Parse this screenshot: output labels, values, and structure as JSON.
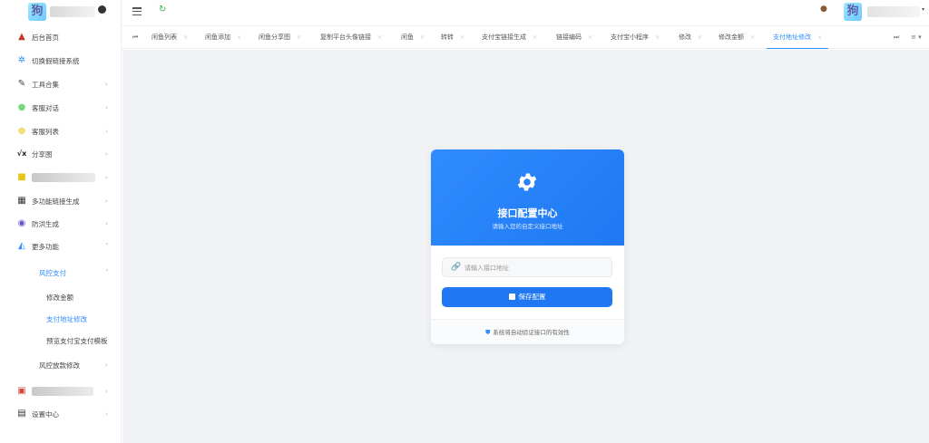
{
  "logo": {
    "avatar_text": "狗"
  },
  "sidebar": {
    "items": [
      {
        "label": "后台首页",
        "icon": "▲",
        "arrow": ""
      },
      {
        "label": "切换假链接系统",
        "icon": "✲",
        "arrow": ""
      },
      {
        "label": "工具合集",
        "icon": "✎",
        "arrow": "›"
      },
      {
        "label": "客服对话",
        "icon": "●",
        "arrow": "›"
      },
      {
        "label": "客服列表",
        "icon": "●",
        "arrow": "›"
      },
      {
        "label": "分享图",
        "icon": "√x",
        "arrow": "›"
      },
      {
        "label": "",
        "icon": "■",
        "arrow": "›"
      },
      {
        "label": "多功能链接生成",
        "icon": "▦",
        "arrow": "›"
      },
      {
        "label": "防洪生成",
        "icon": "◉",
        "arrow": "›"
      },
      {
        "label": "更多功能",
        "icon": "◭",
        "arrow": "˅"
      }
    ],
    "risk": {
      "label": "风控支付",
      "arrow": "˅"
    },
    "risk_sub": [
      "修改金额",
      "支付地址修改",
      "预览支付宝支付模板"
    ],
    "risk_count": {
      "label": "风控放款修改",
      "arrow": "›"
    },
    "hidden_item": {
      "icon": "▣",
      "arrow": "›"
    },
    "settings": {
      "label": "设置中心",
      "icon": "▤",
      "arrow": "›"
    }
  },
  "header": {
    "user_avatar_text": "狗",
    "user_caret": "▾"
  },
  "tabs": {
    "prev": "⏮",
    "next": "⏭",
    "menu": "≡ ▾",
    "items": [
      {
        "label": "闲鱼列表"
      },
      {
        "label": "闲鱼添加"
      },
      {
        "label": "闲鱼分享图"
      },
      {
        "label": "复制平台头像链接"
      },
      {
        "label": "闲鱼"
      },
      {
        "label": "转转"
      },
      {
        "label": "支付宝链接生成"
      },
      {
        "label": "链接编码"
      },
      {
        "label": "支付宝小程序"
      },
      {
        "label": "修改"
      },
      {
        "label": "修改金额"
      },
      {
        "label": "支付地址修改"
      }
    ],
    "close": "×"
  },
  "card": {
    "title": "接口配置中心",
    "subtitle": "请输入您的自定义接口地址",
    "input": {
      "value": "",
      "placeholder": "请输入接口地址"
    },
    "save_label": "保存配置",
    "footer_text": "系统将自动验证接口的有效性"
  },
  "colors": {
    "primary": "#1f78f2",
    "active_tab": "#2f8cff",
    "main_bg": "#f0f2f5"
  },
  "icons": {
    "gear": "gear-icon",
    "link": "link-icon",
    "save": "save-icon",
    "shield": "shield-icon",
    "refresh": "refresh-icon",
    "hamburger": "hamburger-icon"
  }
}
